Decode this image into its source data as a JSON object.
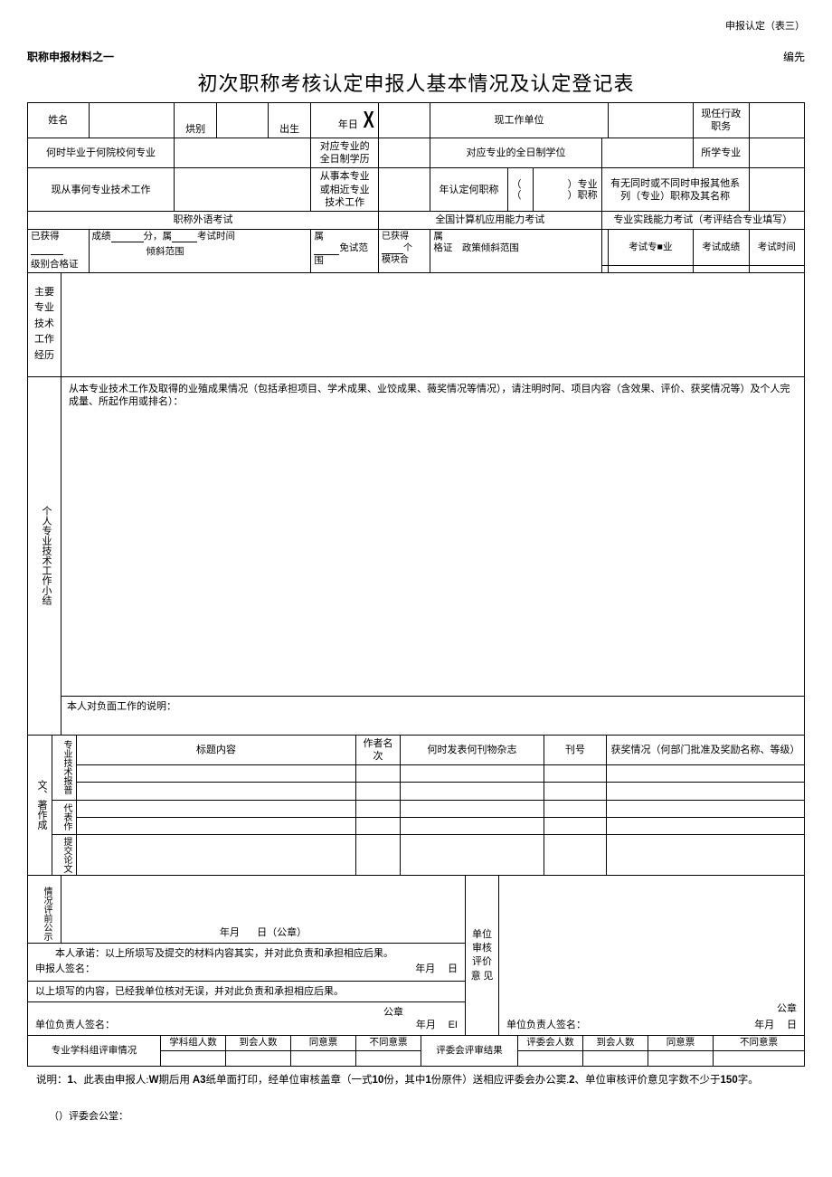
{
  "header": {
    "top_right": "申报认定（表三）",
    "left": "职称申报材料之一",
    "right": "编先",
    "title": "初次职称考核认定申报人基本情况及认定登记表"
  },
  "row1": {
    "name_lbl": "姓名",
    "sex_lbl": "烘别",
    "birth_lbl": "出生",
    "date_lbl": "年日",
    "x": "X",
    "unit_lbl": "现工作单位",
    "post_lbl": "现任行政职务"
  },
  "row2": {
    "grad_lbl": "何时毕业于何院校何专业",
    "edu_lbl": "对应专业的全日制学历",
    "deg_lbl": "对应专业的全日制学位",
    "major_lbl": "所学专业"
  },
  "row3": {
    "now_lbl": "现从事何专业技术工作",
    "same_lbl": "从事本专业或相近专业技术工作",
    "year_lbl": "年认定何职称",
    "b1": "（",
    "b2": "（",
    "e1": "）专业",
    "e2": "）职称",
    "other_lbl": "有无同时或不同时申报其他系列（专业）职称及其名称"
  },
  "row4": {
    "lang_lbl": "职称外语考试",
    "comp_lbl": "全国计算机应用能力考试",
    "prac_lbl": "专业实践能力考试（考评结合专业填写）"
  },
  "row5": {
    "got1": "已获得",
    "score": "成绩",
    "fen": "分，属",
    "time": "考试时间",
    "belong": "属",
    "got2": "已获得",
    "ge": "个",
    "belong2": "属",
    "subj": "考试专■业",
    "score2": "考试成绩",
    "time2": "考试时间"
  },
  "row6": {
    "level": "级别合格证",
    "field": "倾斜范围",
    "exempt": "免试范围",
    "module": "模块合",
    "cert": "格证",
    "policy": "政策倾斜范围"
  },
  "sec1": {
    "label": "主要专业技术工作经历"
  },
  "sec2": {
    "label": "个人专业技术工作小结",
    "intro": "从本专业技术工作及取得的业殖成果情况（包括承担项目、学术成果、业饺成果、薇奖情况等情况），请注明时阿、项目内容（含效果、评价、获奖情况等）及个人完成量、所起作用或排名）：",
    "neg": "本人对负面工作的说明："
  },
  "pub": {
    "side1": "专业技术报普",
    "side2": "代表作",
    "side3": "提交论文",
    "side_outer": "文、著作成",
    "h_title": "标题内容",
    "h_author": "作者名次",
    "h_pub": "何时发表何刊物杂志",
    "h_journal": "刊号",
    "h_award": "获奖情况（何部门批准及奖励名称、等级）"
  },
  "gs": {
    "side": "情况评前公示",
    "date": "年月",
    "day": "日（公章）"
  },
  "sig": {
    "promise": "本人承诺：以上所埙写及提交的材料内容其实，并对此负责和承担相应后果。",
    "applicant": "申报人签名：",
    "ym": "年月",
    "d": "日",
    "unit_check": "以上埙写的内容，已经我单位核对无误，并对此负责和承担相应后果。",
    "seal": "公章",
    "unit_leader": "单位负责人签名：",
    "ym2": "年月",
    "ei": "EI",
    "review_side": "单位审核评价意 见",
    "seal2": "公章",
    "unit_leader2": "单位负责人签名：",
    "ym3": "年月",
    "d3": "日"
  },
  "bottom": {
    "group_lbl": "专业学科组评审情况",
    "h1": "学科组人数",
    "h2": "到会人数",
    "h3": "同意票",
    "h4": "不同意票",
    "result_lbl": "评委会评审结果",
    "h5": "评委会人数",
    "h6": "到会人数",
    "h7": "同意票",
    "h8": "不同意票"
  },
  "note": {
    "pre": "说明：",
    "n1a": "1",
    "t1a": "、此表由申报人:",
    "w": "W",
    "t1b": "期后用",
    "a3": "A3",
    "t1c": "纸单面打印，经单位审核盖章（一式",
    "ten": "10",
    "t1d": "份，其中",
    "one": "1",
    "t1e": "份原件）送相应评委会办公窦.",
    "n2": "2",
    "t2a": "、单位审核评价意见字数不少于",
    "num": "150",
    "t2b": "字。"
  },
  "footer": "（）评委会公堂："
}
